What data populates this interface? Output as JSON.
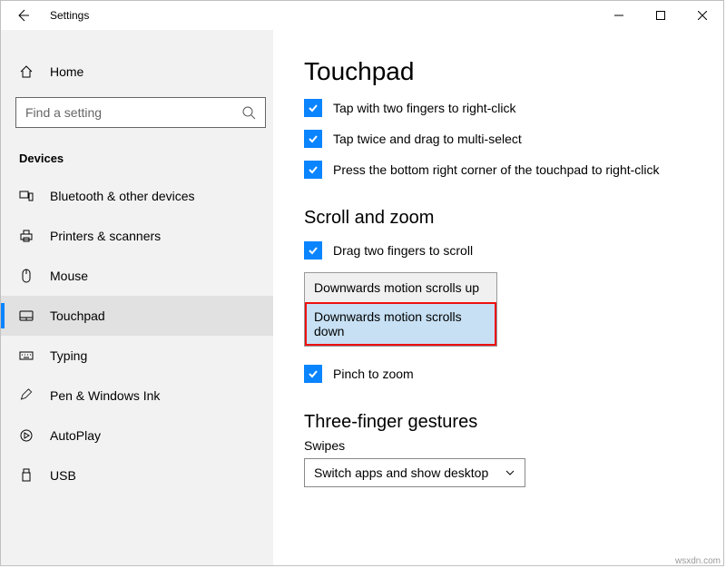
{
  "window": {
    "title": "Settings"
  },
  "sidebar": {
    "home": "Home",
    "search_placeholder": "Find a setting",
    "section": "Devices",
    "items": [
      {
        "label": "Bluetooth & other devices"
      },
      {
        "label": "Printers & scanners"
      },
      {
        "label": "Mouse"
      },
      {
        "label": "Touchpad"
      },
      {
        "label": "Typing"
      },
      {
        "label": "Pen & Windows Ink"
      },
      {
        "label": "AutoPlay"
      },
      {
        "label": "USB"
      }
    ]
  },
  "page": {
    "title": "Touchpad",
    "checks": {
      "two_finger_rightclick": "Tap with two fingers to right-click",
      "tap_twice_drag": "Tap twice and drag to multi-select",
      "bottom_right_rightclick": "Press the bottom right corner of the touchpad to right-click"
    },
    "scroll_zoom_heading": "Scroll and zoom",
    "drag_two_fingers": "Drag two fingers to scroll",
    "scroll_direction": {
      "opt_up": "Downwards motion scrolls up",
      "opt_down": "Downwards motion scrolls down"
    },
    "pinch_zoom": "Pinch to zoom",
    "three_finger_heading": "Three-finger gestures",
    "swipes_label": "Swipes",
    "swipes_value": "Switch apps and show desktop"
  },
  "watermark": "wsxdn.com"
}
